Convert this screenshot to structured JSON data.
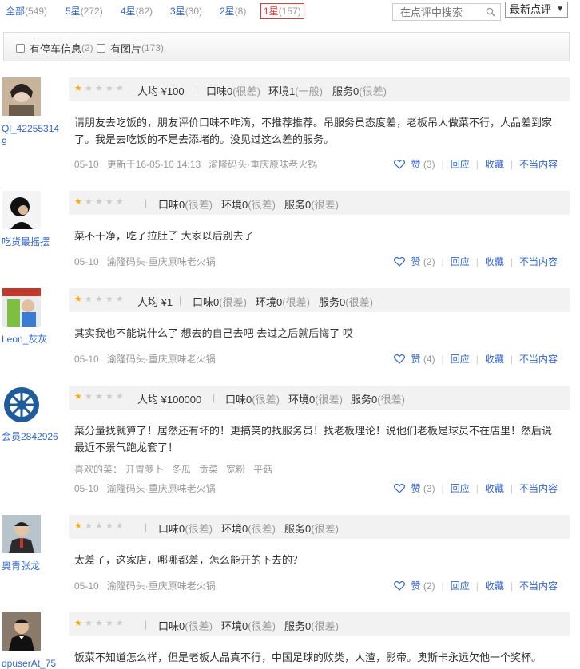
{
  "filters": [
    {
      "label": "全部",
      "count": "(549)"
    },
    {
      "label": "5星",
      "count": "(272)"
    },
    {
      "label": "4星",
      "count": "(82)"
    },
    {
      "label": "3星",
      "count": "(30)"
    },
    {
      "label": "2星",
      "count": "(8)"
    },
    {
      "label": "1星",
      "count": "(157)"
    }
  ],
  "search": {
    "placeholder": "在点评中搜索"
  },
  "sort": {
    "value": "最新点评"
  },
  "options": [
    {
      "label": "有停车信息",
      "count": "(2)"
    },
    {
      "label": "有图片",
      "count": "(173)"
    }
  ],
  "accent_color": "#e4393c",
  "reviews": [
    {
      "user": "Ql_422553149",
      "rating_stars": 1,
      "avg_label": "人均",
      "avg": "¥100",
      "taste": "口味0",
      "taste_q": "(很差)",
      "env": "环境1",
      "env_q": "(一般)",
      "service": "服务0",
      "service_q": "(很差)",
      "text": "请朋友去吃饭的，朋友评价口味不咋滴，不推荐推荐。吊服务员态度差，老板吊人做菜不行，人品差到家了。我是去吃饭的不是去添堵的。没见过这么差的服务。",
      "date": "05-10",
      "updated": "更新于16-05-10 14:13",
      "shop": "渝隆码头·重庆原味老火锅",
      "like": "赞",
      "like_count": "(3)",
      "reply": "回应",
      "fav": "收藏",
      "report": "不当内容"
    },
    {
      "user": "吃货最摇摆",
      "rating_stars": 1,
      "taste": "口味0",
      "taste_q": "(很差)",
      "env": "环境0",
      "env_q": "(很差)",
      "service": "服务0",
      "service_q": "(很差)",
      "text": "菜不干净，吃了拉肚子 大家以后别去了",
      "date": "05-10",
      "shop": "渝隆码头·重庆原味老火锅",
      "like": "赞",
      "like_count": "(2)",
      "reply": "回应",
      "fav": "收藏",
      "report": "不当内容"
    },
    {
      "user": "Leon_灰灰",
      "rating_stars": 1,
      "avg_label": "人均",
      "avg": "¥1",
      "taste": "口味0",
      "taste_q": "(很差)",
      "env": "环境0",
      "env_q": "(很差)",
      "service": "服务0",
      "service_q": "(很差)",
      "text": "其实我也不能说什么了 想去的自己去吧 去过之后就后悔了 哎",
      "date": "05-10",
      "shop": "渝隆码头·重庆原味老火锅",
      "like": "赞",
      "like_count": "(4)",
      "reply": "回应",
      "fav": "收藏",
      "report": "不当内容"
    },
    {
      "user": "会员2842926",
      "rating_stars": 1,
      "avg_label": "人均",
      "avg": "¥100000",
      "taste": "口味0",
      "taste_q": "(很差)",
      "env": "环境0",
      "env_q": "(很差)",
      "service": "服务0",
      "service_q": "(很差)",
      "text": "菜分量找就算了！居然还有坏的！更搞笑的找服务员！找老板理论！说他们老板是球员不在店里！然后说最近不景气跑龙套了！",
      "dishes_label": "喜欢的菜：",
      "dishes": [
        "开胃萝卜",
        "冬瓜",
        "贡菜",
        "宽粉",
        "平菇"
      ],
      "date": "05-10",
      "shop": "渝隆码头·重庆原味老火锅",
      "like": "赞",
      "like_count": "(3)",
      "reply": "回应",
      "fav": "收藏",
      "report": "不当内容"
    },
    {
      "user": "奥青张龙",
      "rating_stars": 1,
      "taste": "口味0",
      "taste_q": "(很差)",
      "env": "环境0",
      "env_q": "(很差)",
      "service": "服务0",
      "service_q": "(很差)",
      "text": "太差了，这家店，哪哪都差，怎么能开的下去的？",
      "date": "05-10",
      "shop": "渝隆码头·重庆原味老火锅",
      "like": "赞",
      "like_count": "(2)",
      "reply": "回应",
      "fav": "收藏",
      "report": "不当内容"
    },
    {
      "user": "dpuserAt_75",
      "rating_stars": 1,
      "taste": "口味0",
      "taste_q": "(很差)",
      "env": "环境0",
      "env_q": "(很差)",
      "service": "服务0",
      "service_q": "(很差)",
      "text": "饭菜不知道怎么样，但是老板人品真不行，中国足球的败类，人渣，影帝。奥斯卡永远欠他一个奖杯。"
    }
  ]
}
